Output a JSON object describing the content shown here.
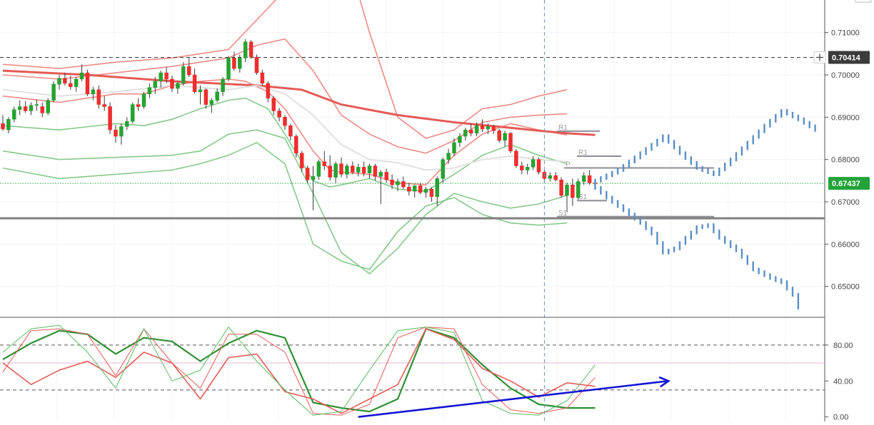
{
  "chart_data": {
    "type": "candlestick",
    "price_axis": {
      "ticks": [
        0.71,
        0.7,
        0.69,
        0.68,
        0.67,
        0.66,
        0.65
      ],
      "tick_labels": [
        "0.71000",
        "0.70000",
        "0.69000",
        "0.68000",
        "0.67000",
        "0.66000",
        "0.65000"
      ],
      "range": [
        0.6427,
        0.7177
      ]
    },
    "price_markers": [
      {
        "value": 0.70414,
        "label": "0.70414",
        "color": "#3b3b3b",
        "line": "dashed",
        "icon": "crosshair-plus-icon"
      },
      {
        "value": 0.67437,
        "label": "0.67437",
        "color": "#22a33a",
        "line": "dotted"
      }
    ],
    "support_line": {
      "value": 0.6661,
      "color": "#808080"
    },
    "pivot_levels": [
      {
        "label": "R1",
        "value": 0.6867
      },
      {
        "label": "R1",
        "value": 0.6808
      },
      {
        "label": "P",
        "value": 0.678
      },
      {
        "label": "S1",
        "value": 0.6703
      },
      {
        "label": "S1",
        "value": 0.6665
      }
    ],
    "candles": [
      [
        0.6885,
        0.6905,
        0.6868,
        0.6872
      ],
      [
        0.687,
        0.69,
        0.6862,
        0.6895
      ],
      [
        0.6895,
        0.6925,
        0.6888,
        0.6918
      ],
      [
        0.6918,
        0.694,
        0.6905,
        0.6925
      ],
      [
        0.6925,
        0.6938,
        0.691,
        0.6915
      ],
      [
        0.6915,
        0.6935,
        0.6905,
        0.6928
      ],
      [
        0.6928,
        0.6942,
        0.6915,
        0.693
      ],
      [
        0.6925,
        0.6935,
        0.69,
        0.691
      ],
      [
        0.691,
        0.6945,
        0.6905,
        0.694
      ],
      [
        0.694,
        0.6985,
        0.6935,
        0.6978
      ],
      [
        0.6978,
        0.7,
        0.6965,
        0.6992
      ],
      [
        0.6992,
        0.7005,
        0.6975,
        0.698
      ],
      [
        0.698,
        0.6998,
        0.6965,
        0.6972
      ],
      [
        0.6972,
        0.6995,
        0.696,
        0.699
      ],
      [
        0.699,
        0.7025,
        0.6985,
        0.7005
      ],
      [
        0.7005,
        0.7012,
        0.695,
        0.6955
      ],
      [
        0.6955,
        0.6972,
        0.694,
        0.6965
      ],
      [
        0.6965,
        0.6975,
        0.692,
        0.693
      ],
      [
        0.693,
        0.695,
        0.6915,
        0.6925
      ],
      [
        0.6925,
        0.6935,
        0.686,
        0.687
      ],
      [
        0.687,
        0.6882,
        0.684,
        0.6855
      ],
      [
        0.6855,
        0.6885,
        0.6835,
        0.6878
      ],
      [
        0.6878,
        0.69,
        0.687,
        0.689
      ],
      [
        0.689,
        0.6935,
        0.6885,
        0.693
      ],
      [
        0.693,
        0.6945,
        0.6915,
        0.6925
      ],
      [
        0.6925,
        0.696,
        0.692,
        0.6955
      ],
      [
        0.6955,
        0.698,
        0.6945,
        0.697
      ],
      [
        0.697,
        0.6995,
        0.6955,
        0.6985
      ],
      [
        0.6985,
        0.701,
        0.697,
        0.7005
      ],
      [
        0.7005,
        0.7018,
        0.698,
        0.699
      ],
      [
        0.699,
        0.6998,
        0.696,
        0.6968
      ],
      [
        0.6968,
        0.6985,
        0.6955,
        0.698
      ],
      [
        0.698,
        0.703,
        0.6975,
        0.702
      ],
      [
        0.702,
        0.704,
        0.6995,
        0.7
      ],
      [
        0.7,
        0.7015,
        0.6955,
        0.696
      ],
      [
        0.696,
        0.6975,
        0.693,
        0.6965
      ],
      [
        0.6965,
        0.6968,
        0.692,
        0.693
      ],
      [
        0.693,
        0.6945,
        0.691,
        0.694
      ],
      [
        0.694,
        0.6968,
        0.6935,
        0.696
      ],
      [
        0.696,
        0.6995,
        0.695,
        0.699
      ],
      [
        0.699,
        0.7045,
        0.6985,
        0.704
      ],
      [
        0.704,
        0.7055,
        0.701,
        0.7015
      ],
      [
        0.7015,
        0.7048,
        0.7005,
        0.704
      ],
      [
        0.704,
        0.7085,
        0.703,
        0.7078
      ],
      [
        0.7078,
        0.7082,
        0.7038,
        0.7042
      ],
      [
        0.7042,
        0.7048,
        0.7,
        0.7005
      ],
      [
        0.7005,
        0.7012,
        0.6975,
        0.698
      ],
      [
        0.698,
        0.6985,
        0.6935,
        0.6945
      ],
      [
        0.6945,
        0.695,
        0.6905,
        0.6915
      ],
      [
        0.6915,
        0.6922,
        0.689,
        0.69
      ],
      [
        0.69,
        0.6905,
        0.687,
        0.688
      ],
      [
        0.688,
        0.6885,
        0.6845,
        0.6855
      ],
      [
        0.6855,
        0.686,
        0.6805,
        0.6815
      ],
      [
        0.6815,
        0.682,
        0.677,
        0.678
      ],
      [
        0.678,
        0.6785,
        0.6745,
        0.6752
      ],
      [
        0.6752,
        0.6785,
        0.668,
        0.676
      ],
      [
        0.676,
        0.68,
        0.6752,
        0.6795
      ],
      [
        0.6795,
        0.682,
        0.6775,
        0.6785
      ],
      [
        0.6785,
        0.681,
        0.675,
        0.6758
      ],
      [
        0.6758,
        0.6795,
        0.6745,
        0.679
      ],
      [
        0.679,
        0.6805,
        0.6758,
        0.6765
      ],
      [
        0.6765,
        0.679,
        0.6755,
        0.6785
      ],
      [
        0.6785,
        0.6795,
        0.6765,
        0.677
      ],
      [
        0.677,
        0.679,
        0.676,
        0.6782
      ],
      [
        0.6782,
        0.6795,
        0.676,
        0.6768
      ],
      [
        0.6768,
        0.679,
        0.6755,
        0.6785
      ],
      [
        0.6785,
        0.679,
        0.675,
        0.676
      ],
      [
        0.676,
        0.6775,
        0.6695,
        0.677
      ],
      [
        0.677,
        0.6778,
        0.6745,
        0.6752
      ],
      [
        0.6752,
        0.6765,
        0.673,
        0.674
      ],
      [
        0.674,
        0.6755,
        0.6725,
        0.6748
      ],
      [
        0.6748,
        0.676,
        0.673,
        0.6735
      ],
      [
        0.6735,
        0.6745,
        0.6715,
        0.6725
      ],
      [
        0.6725,
        0.674,
        0.671,
        0.6738
      ],
      [
        0.6738,
        0.6745,
        0.6718,
        0.6722
      ],
      [
        0.6722,
        0.6735,
        0.671,
        0.673
      ],
      [
        0.673,
        0.6735,
        0.67,
        0.6712
      ],
      [
        0.6712,
        0.676,
        0.669,
        0.6755
      ],
      [
        0.6755,
        0.6805,
        0.6745,
        0.68
      ],
      [
        0.68,
        0.6825,
        0.679,
        0.6815
      ],
      [
        0.6815,
        0.685,
        0.6808,
        0.684
      ],
      [
        0.684,
        0.6862,
        0.683,
        0.6855
      ],
      [
        0.6855,
        0.6875,
        0.6845,
        0.687
      ],
      [
        0.687,
        0.6885,
        0.6855,
        0.6862
      ],
      [
        0.6862,
        0.6888,
        0.6855,
        0.688
      ],
      [
        0.688,
        0.6895,
        0.6865,
        0.6872
      ],
      [
        0.6872,
        0.6885,
        0.686,
        0.6878
      ],
      [
        0.6878,
        0.6882,
        0.686,
        0.6868
      ],
      [
        0.6868,
        0.6872,
        0.684,
        0.6845
      ],
      [
        0.6845,
        0.6868,
        0.683,
        0.6862
      ],
      [
        0.6862,
        0.6865,
        0.6815,
        0.682
      ],
      [
        0.682,
        0.6825,
        0.678,
        0.6785
      ],
      [
        0.6785,
        0.6795,
        0.6765,
        0.6775
      ],
      [
        0.6775,
        0.679,
        0.6765,
        0.6782
      ],
      [
        0.6782,
        0.6808,
        0.6775,
        0.68
      ],
      [
        0.68,
        0.6805,
        0.6765,
        0.677
      ],
      [
        0.677,
        0.6775,
        0.6745,
        0.6755
      ],
      [
        0.6755,
        0.677,
        0.6748,
        0.6762
      ],
      [
        0.6762,
        0.677,
        0.6748,
        0.6752
      ],
      [
        0.6752,
        0.6758,
        0.671,
        0.6715
      ],
      [
        0.6715,
        0.6745,
        0.6675,
        0.674
      ],
      [
        0.674,
        0.6755,
        0.669,
        0.671
      ],
      [
        0.671,
        0.6755,
        0.6705,
        0.6748
      ],
      [
        0.6748,
        0.677,
        0.674,
        0.6762
      ],
      [
        0.6762,
        0.6775,
        0.674,
        0.6745
      ],
      [
        0.6745,
        0.6752,
        0.6738,
        0.6744
      ]
    ],
    "moving_averages": [
      {
        "color": "#e55a56",
        "width": 3,
        "x": [
          0,
          15,
          30,
          45,
          53,
          60,
          70,
          80,
          90,
          95,
          100,
          105
        ],
        "y": [
          0.701,
          0.7,
          0.6985,
          0.6975,
          0.6965,
          0.693,
          0.6905,
          0.6888,
          0.6875,
          0.6868,
          0.6862,
          0.6858
        ]
      },
      {
        "color": "#e0e0e0",
        "width": 2,
        "x": [
          0,
          10,
          20,
          30,
          40,
          45,
          50,
          55,
          60,
          65,
          70,
          75,
          80,
          85,
          90,
          95,
          100
        ],
        "y": [
          0.6965,
          0.695,
          0.696,
          0.6975,
          0.6965,
          0.6975,
          0.6955,
          0.6905,
          0.6835,
          0.68,
          0.6792,
          0.6775,
          0.678,
          0.68,
          0.6808,
          0.68,
          0.6795
        ]
      }
    ],
    "band_lines": [
      {
        "color": "#ee8a84",
        "x": [
          0,
          10,
          20,
          30,
          35,
          40,
          45,
          50,
          55,
          60,
          65,
          70,
          75,
          80,
          85,
          90,
          95,
          100
        ],
        "y": [
          0.7025,
          0.7015,
          0.703,
          0.704,
          0.705,
          0.706,
          0.713,
          0.72,
          0.726,
          0.733,
          0.71,
          0.69,
          0.685,
          0.687,
          0.692,
          0.693,
          0.695,
          0.6965
        ]
      },
      {
        "color": "#ee8a84",
        "x": [
          0,
          10,
          20,
          30,
          35,
          40,
          45,
          50,
          55,
          60,
          65,
          70,
          75,
          80,
          85,
          90,
          95,
          100
        ],
        "y": [
          0.7,
          0.699,
          0.7005,
          0.702,
          0.703,
          0.704,
          0.707,
          0.7085,
          0.701,
          0.6905,
          0.686,
          0.683,
          0.6815,
          0.6845,
          0.6888,
          0.69,
          0.6905,
          0.6908
        ]
      },
      {
        "color": "#f08a84",
        "x": [
          0,
          10,
          20,
          25,
          30,
          35,
          40,
          43,
          47,
          50,
          55,
          58,
          60,
          65,
          70,
          75,
          80,
          85,
          90,
          95,
          100
        ],
        "y": [
          0.695,
          0.6935,
          0.6955,
          0.6955,
          0.6975,
          0.6985,
          0.699,
          0.6985,
          0.696,
          0.692,
          0.682,
          0.6775,
          0.677,
          0.6765,
          0.6745,
          0.674,
          0.681,
          0.686,
          0.6885,
          0.687,
          0.6858
        ]
      },
      {
        "color": "#86c98a",
        "x": [
          0,
          10,
          20,
          25,
          30,
          35,
          40,
          43,
          47,
          50,
          55,
          58,
          60,
          65,
          70,
          75,
          80,
          85,
          90,
          95,
          100
        ],
        "y": [
          0.688,
          0.687,
          0.6885,
          0.688,
          0.6895,
          0.692,
          0.694,
          0.6945,
          0.692,
          0.686,
          0.675,
          0.6735,
          0.674,
          0.6755,
          0.673,
          0.6725,
          0.6765,
          0.681,
          0.6835,
          0.681,
          0.679
        ]
      },
      {
        "color": "#86c98a",
        "x": [
          0,
          10,
          20,
          30,
          35,
          40,
          45,
          50,
          55,
          60,
          65,
          70,
          75,
          80,
          85,
          90,
          95,
          100
        ],
        "y": [
          0.682,
          0.68,
          0.6805,
          0.681,
          0.682,
          0.686,
          0.687,
          0.685,
          0.672,
          0.658,
          0.653,
          0.659,
          0.667,
          0.672,
          0.67,
          0.6685,
          0.6695,
          0.6715
        ]
      },
      {
        "color": "#86c98a",
        "x": [
          0,
          10,
          20,
          30,
          35,
          40,
          45,
          50,
          55,
          60,
          65,
          70,
          75,
          80,
          85,
          90,
          95,
          100
        ],
        "y": [
          0.678,
          0.6755,
          0.6765,
          0.6775,
          0.679,
          0.681,
          0.684,
          0.679,
          0.66,
          0.656,
          0.654,
          0.663,
          0.669,
          0.671,
          0.667,
          0.665,
          0.6645,
          0.665
        ]
      }
    ],
    "forecast_paths": [
      {
        "color": "#5a8fc6",
        "points": [
          [
            105,
            0.6744
          ],
          [
            110,
            0.6775
          ],
          [
            115,
            0.6825
          ],
          [
            118,
            0.6855
          ],
          [
            121,
            0.6815
          ],
          [
            124,
            0.678
          ],
          [
            127,
            0.6765
          ],
          [
            130,
            0.68
          ],
          [
            133,
            0.684
          ],
          [
            136,
            0.688
          ],
          [
            139,
            0.6915
          ],
          [
            142,
            0.6895
          ],
          [
            145,
            0.687
          ]
        ]
      },
      {
        "color": "#5a8fc6",
        "points": [
          [
            105,
            0.6744
          ],
          [
            108,
            0.671
          ],
          [
            111,
            0.668
          ],
          [
            114,
            0.665
          ],
          [
            116,
            0.6625
          ],
          [
            118,
            0.658
          ],
          [
            120,
            0.659
          ],
          [
            122,
            0.6615
          ],
          [
            124,
            0.664
          ],
          [
            126,
            0.6645
          ],
          [
            128,
            0.6615
          ],
          [
            131,
            0.6585
          ],
          [
            134,
            0.654
          ],
          [
            137,
            0.652
          ],
          [
            139,
            0.651
          ],
          [
            141,
            0.648
          ],
          [
            142,
            0.645
          ]
        ]
      }
    ],
    "oscillator": {
      "ticks": [
        80.0,
        40.0,
        0.0
      ],
      "tick_labels": [
        "80.00",
        "40.00",
        "0.00"
      ],
      "range": [
        -5,
        110
      ],
      "levels": [
        80,
        30
      ],
      "midline": 60,
      "x": [
        0,
        5,
        10,
        15,
        20,
        25,
        30,
        35,
        40,
        45,
        50,
        55,
        60,
        65,
        70,
        75,
        80,
        85,
        90,
        95,
        100,
        105
      ],
      "series": [
        {
          "color": "#2f8f33",
          "width": 2.2,
          "y": [
            64,
            82,
            96,
            92,
            70,
            88,
            84,
            62,
            82,
            96,
            88,
            16,
            10,
            6,
            20,
            98,
            88,
            58,
            32,
            14,
            10,
            10
          ]
        },
        {
          "color": "#e45c56",
          "width": 1.6,
          "y": [
            60,
            36,
            52,
            62,
            44,
            72,
            60,
            20,
            66,
            70,
            28,
            20,
            4,
            20,
            36,
            98,
            86,
            54,
            40,
            22,
            38,
            34
          ]
        },
        {
          "color": "#e45c56",
          "width": 1.0,
          "y": [
            50,
            96,
            98,
            92,
            46,
            98,
            60,
            32,
            92,
            92,
            72,
            4,
            2,
            14,
            88,
            100,
            98,
            36,
            8,
            4,
            10,
            44
          ]
        },
        {
          "color": "#5aba5e",
          "width": 1.0,
          "y": [
            72,
            98,
            102,
            72,
            32,
            98,
            40,
            52,
            100,
            62,
            30,
            2,
            6,
            52,
            96,
            100,
            94,
            18,
            4,
            2,
            18,
            58
          ]
        }
      ],
      "trend_arrow": {
        "color": "#1414d6",
        "start": [
          63,
          0
        ],
        "end": [
          118,
          40
        ]
      }
    },
    "time_cursor": 96
  }
}
